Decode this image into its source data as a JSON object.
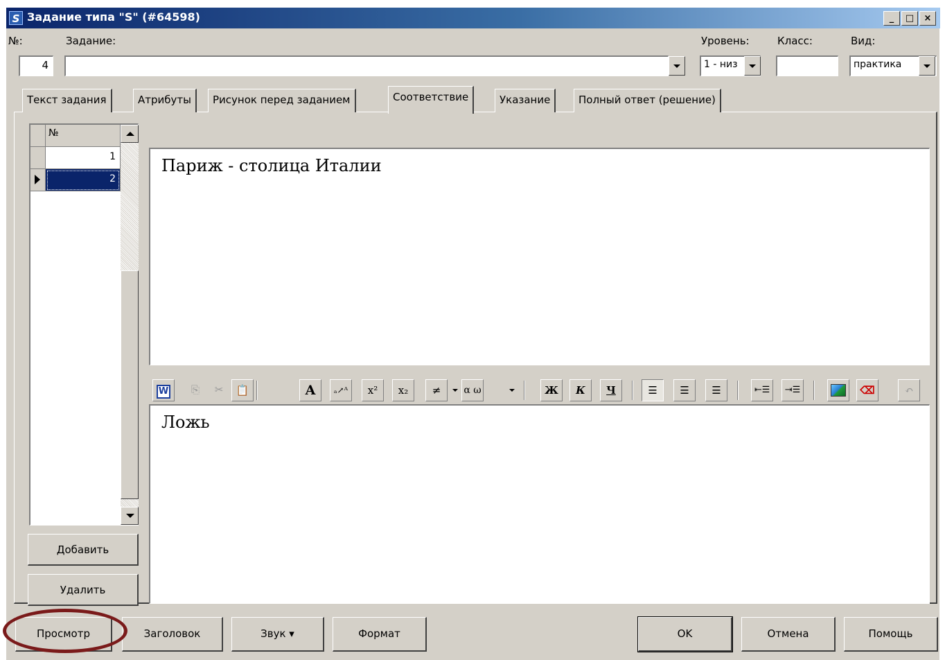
{
  "title": "Задание типа \"S\" (#64598)",
  "window_buttons": {
    "minimize": "_",
    "maximize": "□",
    "close": "×"
  },
  "header": {
    "number_label": "№:",
    "number_value": "4",
    "task_label": "Задание:",
    "task_value": "",
    "level_label": "Уровень:",
    "level_value": "1 - низ",
    "class_label": "Класс:",
    "class_value": "",
    "kind_label": "Вид:",
    "kind_value": "практика"
  },
  "tabs": [
    {
      "label": "Текст задания"
    },
    {
      "label": "Атрибуты"
    },
    {
      "label": "Рисунок перед заданием"
    },
    {
      "label": "Соответствие",
      "active": true
    },
    {
      "label": "Указание"
    },
    {
      "label": "Полный ответ (решение)"
    }
  ],
  "grid": {
    "header": "№",
    "rows": [
      "1",
      "2"
    ],
    "selected_row": 2
  },
  "side_buttons": {
    "add": "Добавить",
    "delete": "Удалить"
  },
  "editors": {
    "statement": "Париж - столица Италии",
    "answer": "Ложь"
  },
  "toolbar": {
    "font_label": "A",
    "superscript": "x²",
    "subscript": "x₂",
    "bold": "Ж",
    "italic": "К",
    "underline": "Ч",
    "symbols_label": "α ω"
  },
  "footer_buttons": {
    "preview": "Просмотр",
    "heading": "Заголовок",
    "sound": "Звук ▾",
    "format": "Формат",
    "ok": "OK",
    "cancel": "Отмена",
    "help": "Помощь"
  },
  "colors": {
    "titlebar": "#0a246a",
    "selection": "#0a246a",
    "highlight_ring": "#7a1a1a"
  }
}
